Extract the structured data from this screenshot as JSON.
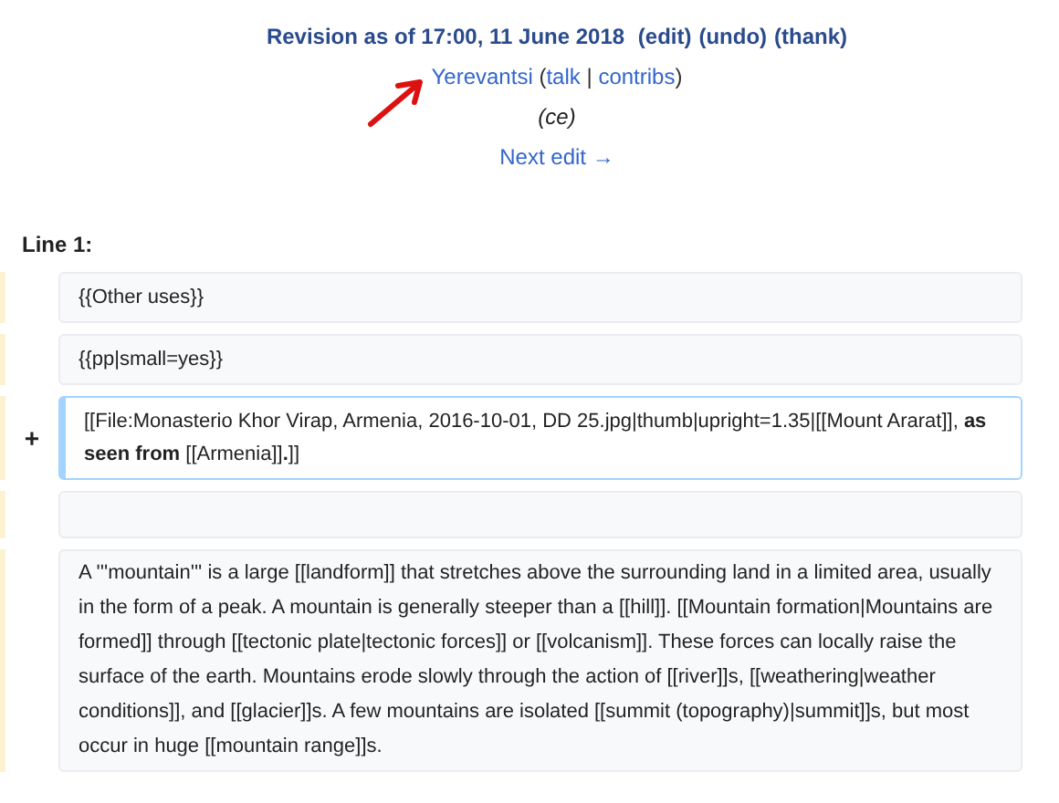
{
  "revision": {
    "title": "Revision as of 17:00, 11 June 2018",
    "actions": [
      "(edit)",
      "(undo)",
      "(thank)"
    ]
  },
  "user": {
    "name": "Yerevantsi",
    "open": "(",
    "talk": "talk",
    "separator": "|",
    "contribs": "contribs",
    "close": ")"
  },
  "summary": "(ce)",
  "next_edit": "Next edit →",
  "line_label": "Line 1:",
  "rows": [
    {
      "kind": "context",
      "text": "{{Other uses}}"
    },
    {
      "kind": "context",
      "text": "{{pp|small=yes}}"
    },
    {
      "kind": "added",
      "marker": "+",
      "text": "[[File:Monasterio Khor Virap, Armenia, 2016-10-01, DD 25.jpg|thumb|upright=1.35|[[Mount Ararat]], **as seen from** [[Armenia]]**.**]]"
    },
    {
      "kind": "empty"
    },
    {
      "kind": "context",
      "text": "A '''mountain''' is a large [[landform]] that stretches above the surrounding land in a limited area, usually in the form of a peak. A mountain is generally steeper than a [[hill]]. [[Mountain formation|Mountains are formed]] through [[tectonic plate|tectonic forces]] or [[volcanism]]. These forces can locally raise the surface of the earth. Mountains erode slowly through the action of [[river]]s, [[weathering|weather conditions]], and [[glacier]]s. A few mountains are isolated [[summit (topography)|summit]]s, but most occur in huge [[mountain range]]s."
    }
  ]
}
